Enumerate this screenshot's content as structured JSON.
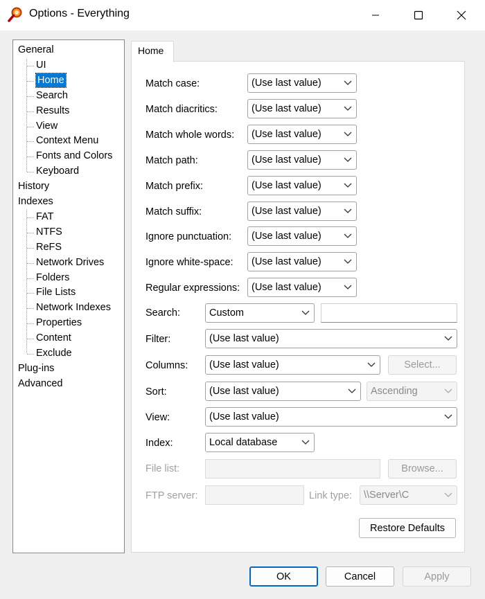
{
  "window": {
    "title": "Options - Everything"
  },
  "tree": [
    {
      "label": "General",
      "level": 0
    },
    {
      "label": "UI",
      "level": 1
    },
    {
      "label": "Home",
      "level": 1,
      "selected": true
    },
    {
      "label": "Search",
      "level": 1
    },
    {
      "label": "Results",
      "level": 1
    },
    {
      "label": "View",
      "level": 1
    },
    {
      "label": "Context Menu",
      "level": 1
    },
    {
      "label": "Fonts and Colors",
      "level": 1
    },
    {
      "label": "Keyboard",
      "level": 1
    },
    {
      "label": "History",
      "level": 0
    },
    {
      "label": "Indexes",
      "level": 0
    },
    {
      "label": "FAT",
      "level": 1
    },
    {
      "label": "NTFS",
      "level": 1
    },
    {
      "label": "ReFS",
      "level": 1
    },
    {
      "label": "Network Drives",
      "level": 1
    },
    {
      "label": "Folders",
      "level": 1
    },
    {
      "label": "File Lists",
      "level": 1
    },
    {
      "label": "Network Indexes",
      "level": 1
    },
    {
      "label": "Properties",
      "level": 1
    },
    {
      "label": "Content",
      "level": 1
    },
    {
      "label": "Exclude",
      "level": 1
    },
    {
      "label": "Plug-ins",
      "level": 0
    },
    {
      "label": "Advanced",
      "level": 0
    }
  ],
  "tab": {
    "label": "Home"
  },
  "match_options": [
    {
      "label": "Match case:",
      "value": "(Use last value)"
    },
    {
      "label": "Match diacritics:",
      "value": "(Use last value)"
    },
    {
      "label": "Match whole words:",
      "value": "(Use last value)"
    },
    {
      "label": "Match path:",
      "value": "(Use last value)"
    },
    {
      "label": "Match prefix:",
      "value": "(Use last value)"
    },
    {
      "label": "Match suffix:",
      "value": "(Use last value)"
    },
    {
      "label": "Ignore punctuation:",
      "value": "(Use last value)"
    },
    {
      "label": "Ignore white-space:",
      "value": "(Use last value)"
    },
    {
      "label": "Regular expressions:",
      "value": "(Use last value)"
    }
  ],
  "search": {
    "label": "Search:",
    "value": "Custom",
    "text": ""
  },
  "filter": {
    "label": "Filter:",
    "value": "(Use last value)"
  },
  "columns": {
    "label": "Columns:",
    "value": "(Use last value)",
    "button": "Select..."
  },
  "sort": {
    "label": "Sort:",
    "value": "(Use last value)",
    "order": "Ascending"
  },
  "view": {
    "label": "View:",
    "value": "(Use last value)"
  },
  "index": {
    "label": "Index:",
    "value": "Local database"
  },
  "file_list": {
    "label": "File list:",
    "value": "",
    "button": "Browse..."
  },
  "ftp": {
    "label": "FTP server:",
    "value": "",
    "link_label": "Link type:",
    "link_value": "\\\\Server\\C"
  },
  "restore_label": "Restore Defaults",
  "footer": {
    "ok": "OK",
    "cancel": "Cancel",
    "apply": "Apply"
  }
}
